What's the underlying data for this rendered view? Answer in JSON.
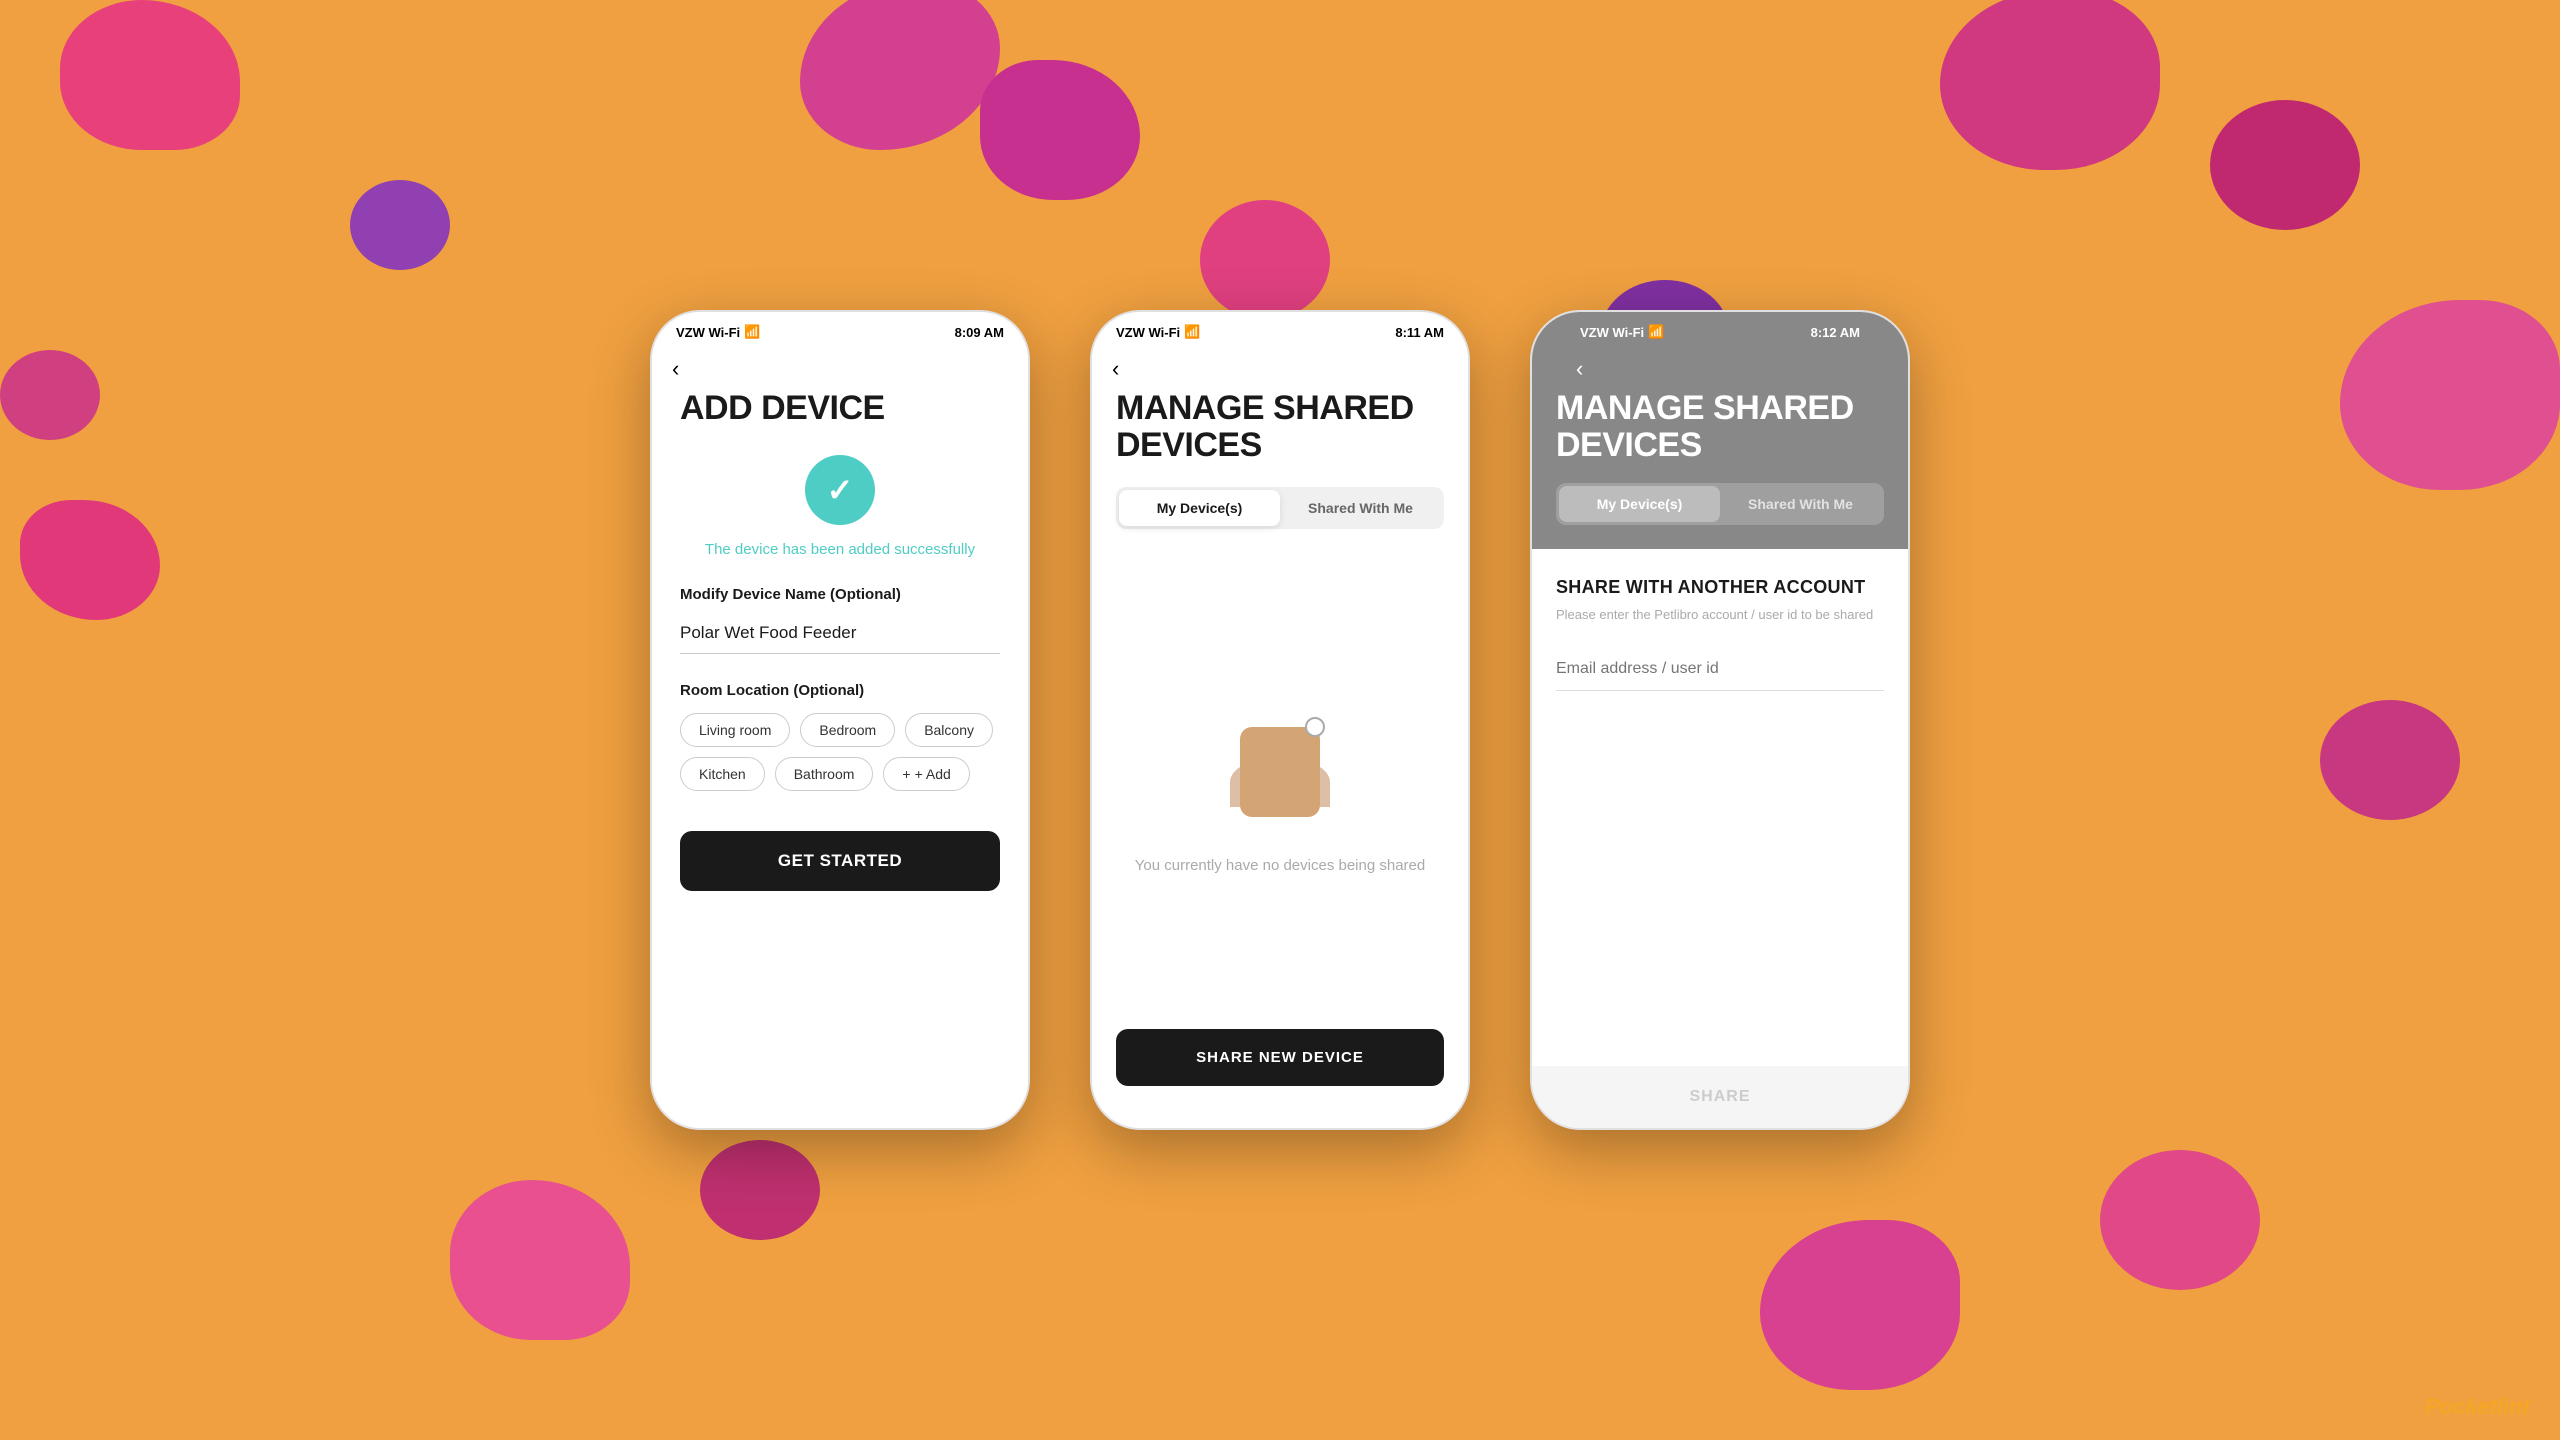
{
  "background": {
    "color": "#F0A040"
  },
  "watermark": {
    "text1": "P",
    "text2": "ocketlint"
  },
  "phone1": {
    "statusBar": {
      "carrier": "VZW Wi-Fi",
      "time": "8:09 AM"
    },
    "title": "ADD DEVICE",
    "successText": "The device has been added successfully",
    "deviceNameLabel": "Modify Device Name (Optional)",
    "deviceNameValue": "Polar Wet Food Feeder",
    "roomLabel": "Room Location (Optional)",
    "rooms": [
      "Living room",
      "Bedroom",
      "Balcony",
      "Kitchen",
      "Bathroom"
    ],
    "addLabel": "+ Add",
    "ctaButton": "GET STARTED"
  },
  "phone2": {
    "statusBar": {
      "carrier": "VZW Wi-Fi",
      "time": "8:11 AM"
    },
    "title": "MANAGE SHARED\nDEVICES",
    "tabs": [
      "My Device(s)",
      "Shared With Me"
    ],
    "activeTab": 0,
    "emptyText": "You currently have no devices being shared",
    "ctaButton": "SHARE NEW DEVICE"
  },
  "phone3": {
    "statusBar": {
      "carrier": "VZW Wi-Fi",
      "time": "8:12 AM"
    },
    "title": "MANAGE SHARED\nDEVICES",
    "tabs": [
      "My Device(s)",
      "Shared With Me"
    ],
    "activeTab": 0,
    "shareTitle": "SHARE WITH ANOTHER ACCOUNT",
    "shareSubtitle": "Please enter the Petlibro account / user id to be shared",
    "emailPlaceholder": "Email address / user id",
    "shareButton": "SHARE"
  }
}
